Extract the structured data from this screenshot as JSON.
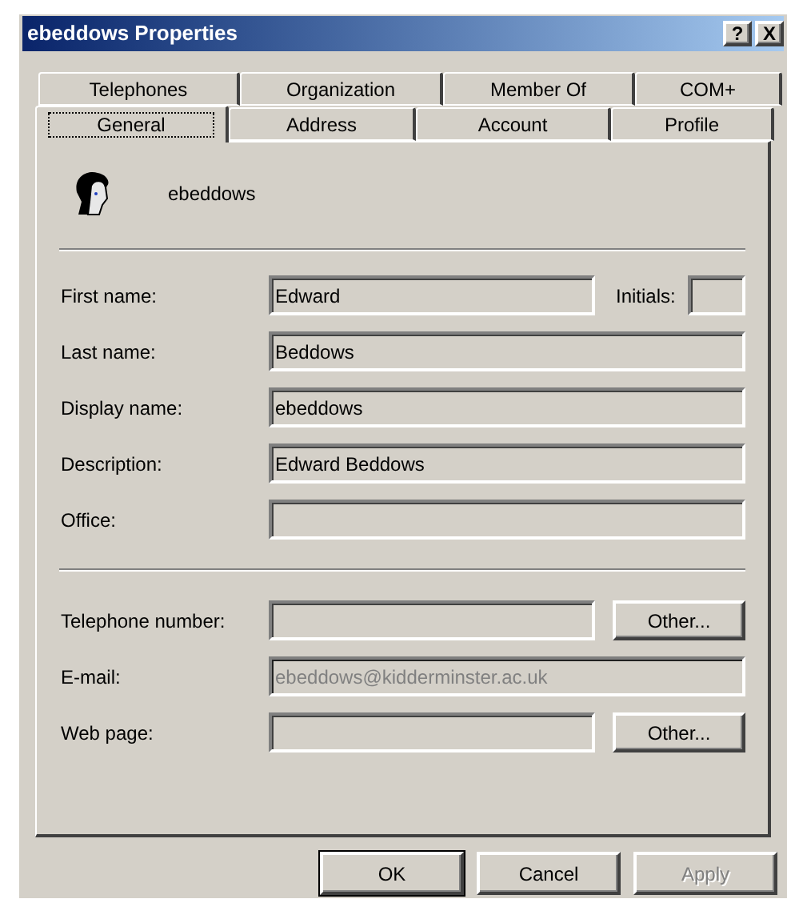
{
  "window": {
    "title": "ebeddows Properties",
    "title_buttons": [
      "?",
      "X"
    ]
  },
  "tab_rows": [
    [
      {
        "label": "Telephones",
        "selected": false
      },
      {
        "label": "Organization",
        "selected": false
      },
      {
        "label": "Member Of",
        "selected": false
      },
      {
        "label": "COM+",
        "selected": false
      }
    ],
    [
      {
        "label": "General",
        "selected": true
      },
      {
        "label": "Address",
        "selected": false
      },
      {
        "label": "Account",
        "selected": false
      },
      {
        "label": "Profile",
        "selected": false
      }
    ]
  ],
  "user": {
    "name": "ebeddows"
  },
  "name_fields": [
    {
      "label": "First name:",
      "value": "Edward",
      "disabled": false,
      "extra": {
        "label": "Initials:"
      }
    },
    {
      "label": "Last name:",
      "value": "Beddows",
      "disabled": false
    },
    {
      "label": "Display name:",
      "value": "ebeddows",
      "disabled": false
    },
    {
      "label": "Description:",
      "value": "Edward Beddows",
      "disabled": false
    },
    {
      "label": "Office:",
      "disabled": false
    }
  ],
  "contact_fields": [
    {
      "label": "Telephone number:",
      "disabled": false,
      "button": "Other..."
    },
    {
      "label": "E-mail:",
      "value": "ebeddows@kidderminster.ac.uk",
      "disabled": true
    },
    {
      "label": "Web page:",
      "disabled": false,
      "button": "Other..."
    }
  ],
  "buttons": [
    {
      "label": "OK",
      "default": true,
      "disabled": false
    },
    {
      "label": "Cancel",
      "default": false,
      "disabled": false
    },
    {
      "label": "Apply",
      "default": false,
      "disabled": true
    }
  ]
}
